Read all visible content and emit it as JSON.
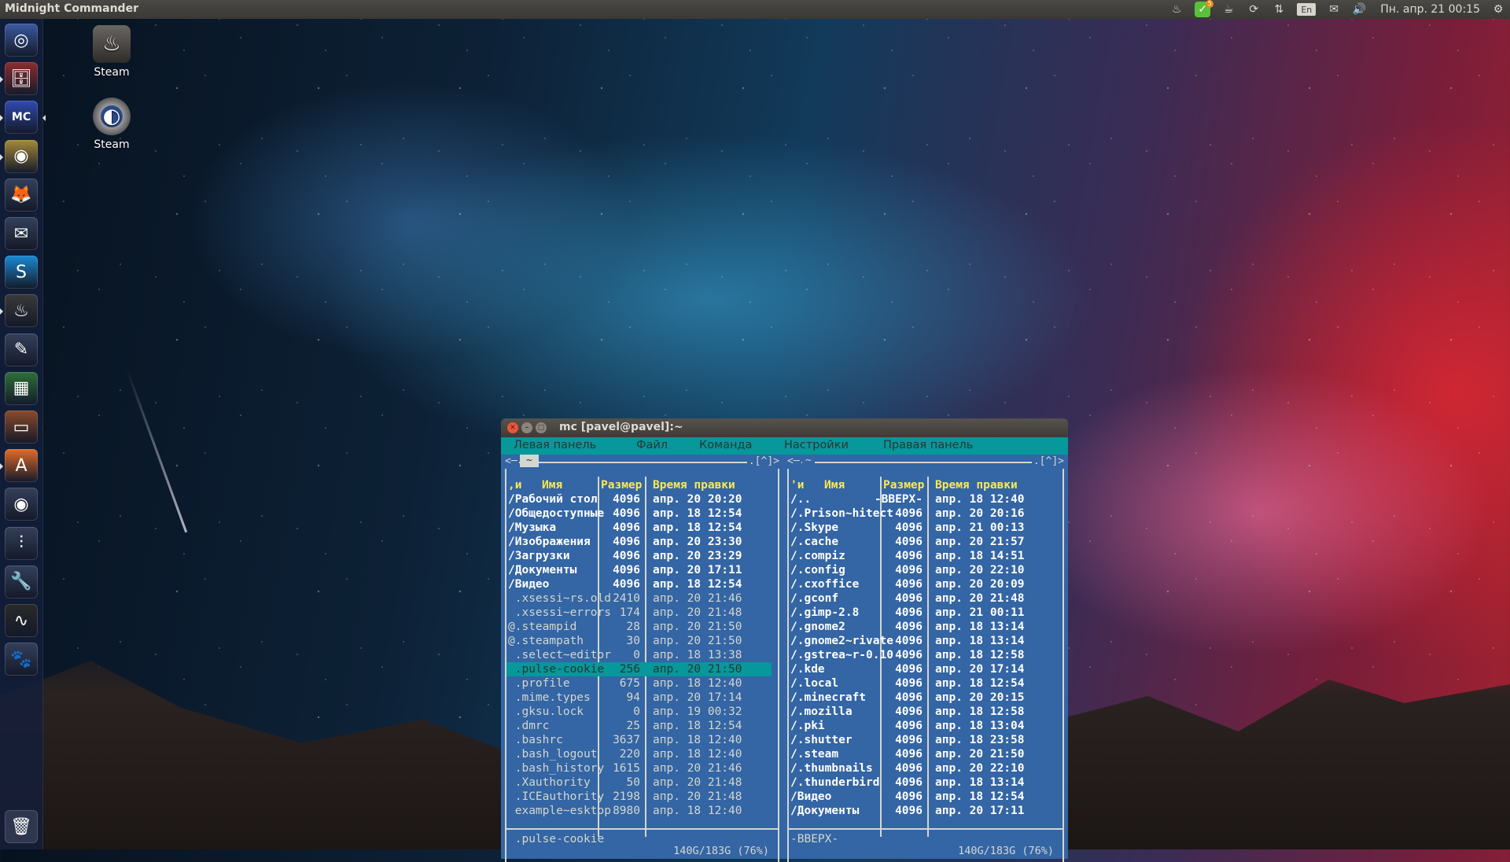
{
  "topbar": {
    "app_title": "Midnight Commander",
    "indicators": [
      {
        "icon": "steam-icon",
        "glyph": "♨"
      },
      {
        "icon": "skype-status-icon",
        "glyph": "✓",
        "badge": "5"
      },
      {
        "icon": "cup-icon",
        "glyph": "☕"
      },
      {
        "icon": "sync-icon",
        "glyph": "⟳"
      },
      {
        "icon": "network-icon",
        "glyph": "⇅"
      },
      {
        "icon": "keyboard-layout-icon",
        "glyph": "En"
      },
      {
        "icon": "mail-icon",
        "glyph": "✉"
      },
      {
        "icon": "volume-icon",
        "glyph": "🔊"
      }
    ],
    "clock": "Пн. апр. 21 00:15",
    "session_icon": "⚙"
  },
  "launcher": {
    "items": [
      {
        "name": "dash-home",
        "glyph": "◎",
        "bg": "#3b5aa0"
      },
      {
        "name": "files",
        "glyph": "🗄",
        "bg": "#8a2e2e"
      },
      {
        "name": "midnight-commander",
        "glyph": "MC",
        "bg": "#2f4bb0",
        "active": true
      },
      {
        "name": "chrome",
        "glyph": "◉",
        "bg": "#a58a3a"
      },
      {
        "name": "firefox",
        "glyph": "🦊",
        "bg": "#34405a"
      },
      {
        "name": "thunderbird",
        "glyph": "✉",
        "bg": "#34405a"
      },
      {
        "name": "skype",
        "glyph": "S",
        "bg": "#1a8ad4"
      },
      {
        "name": "steam",
        "glyph": "♨",
        "bg": "#3a3a3a"
      },
      {
        "name": "libreoffice-writer",
        "glyph": "✎",
        "bg": "#34405a"
      },
      {
        "name": "libreoffice-calc",
        "glyph": "▦",
        "bg": "#2f6f3a"
      },
      {
        "name": "libreoffice-impress",
        "glyph": "▭",
        "bg": "#8a4a2a"
      },
      {
        "name": "software-center",
        "glyph": "A",
        "bg": "#e06b2a"
      },
      {
        "name": "audio-player",
        "glyph": "◉",
        "bg": "#34405a"
      },
      {
        "name": "sound-mixer",
        "glyph": "⫶",
        "bg": "#34405a"
      },
      {
        "name": "system-settings",
        "glyph": "🔧",
        "bg": "#34405a"
      },
      {
        "name": "system-monitor",
        "glyph": "∿",
        "bg": "#2a2a2a"
      },
      {
        "name": "gimp",
        "glyph": "🐾",
        "bg": "#34405a"
      }
    ],
    "trash": {
      "name": "trash",
      "glyph": "🗑"
    }
  },
  "desktop_icons": [
    {
      "label": "Steam",
      "glyph": "♨"
    },
    {
      "label": "Steam",
      "glyph": "◐"
    }
  ],
  "window": {
    "title": "mc [pavel@pavel]:~",
    "menu": [
      "Левая панель",
      "Файл",
      "Команда",
      "Настройки",
      "Правая панель"
    ]
  },
  "left_panel": {
    "corner_left": "<─",
    "path": "~",
    "corner_right": ".[^]>",
    "sort_indicator": ",и",
    "headers": {
      "name": "Имя",
      "size": "Размер",
      "mtime": "Время правки"
    },
    "rows": [
      {
        "name": "/Рабочий стол",
        "size": "4096",
        "mtime": "апр. 20 20:20",
        "dir": true
      },
      {
        "name": "/Общедоступные",
        "size": "4096",
        "mtime": "апр. 18 12:54",
        "dir": true
      },
      {
        "name": "/Музыка",
        "size": "4096",
        "mtime": "апр. 18 12:54",
        "dir": true
      },
      {
        "name": "/Изображения",
        "size": "4096",
        "mtime": "апр. 20 23:30",
        "dir": true
      },
      {
        "name": "/Загрузки",
        "size": "4096",
        "mtime": "апр. 20 23:29",
        "dir": true
      },
      {
        "name": "/Документы",
        "size": "4096",
        "mtime": "апр. 20 17:11",
        "dir": true
      },
      {
        "name": "/Видео",
        "size": "4096",
        "mtime": "апр. 18 12:54",
        "dir": true
      },
      {
        "name": " .xsessi~rs.old",
        "size": "2410",
        "mtime": "апр. 20 21:46"
      },
      {
        "name": " .xsessi~errors",
        "size": "174",
        "mtime": "апр. 20 21:48"
      },
      {
        "name": "@.steampid",
        "size": "28",
        "mtime": "апр. 20 21:50"
      },
      {
        "name": "@.steampath",
        "size": "30",
        "mtime": "апр. 20 21:50"
      },
      {
        "name": " .select~editor",
        "size": "0",
        "mtime": "апр. 18 13:38"
      },
      {
        "name": " .pulse-cookie",
        "size": "256",
        "mtime": "апр. 20 21:50",
        "selected": true
      },
      {
        "name": " .profile",
        "size": "675",
        "mtime": "апр. 18 12:40"
      },
      {
        "name": " .mime.types",
        "size": "94",
        "mtime": "апр. 20 17:14"
      },
      {
        "name": " .gksu.lock",
        "size": "0",
        "mtime": "апр. 19 00:32"
      },
      {
        "name": " .dmrc",
        "size": "25",
        "mtime": "апр. 18 12:54"
      },
      {
        "name": " .bashrc",
        "size": "3637",
        "mtime": "апр. 18 12:40"
      },
      {
        "name": " .bash_logout",
        "size": "220",
        "mtime": "апр. 18 12:40"
      },
      {
        "name": " .bash_history",
        "size": "1615",
        "mtime": "апр. 20 21:46"
      },
      {
        "name": " .Xauthority",
        "size": "50",
        "mtime": "апр. 20 21:48"
      },
      {
        "name": " .ICEauthority",
        "size": "2198",
        "mtime": "апр. 20 21:48"
      },
      {
        "name": " example~esktop",
        "size": "8980",
        "mtime": "апр. 18 12:40"
      }
    ],
    "status": " .pulse-cookie",
    "footer": "140G/183G (76%)"
  },
  "right_panel": {
    "corner_left": "<─",
    "path": "~",
    "corner_right": ".[^]>",
    "sort_indicator": "'и",
    "headers": {
      "name": "Имя",
      "size": "Размер",
      "mtime": "Время правки"
    },
    "rows": [
      {
        "name": "/..",
        "size": "-ВВЕРХ-",
        "mtime": "апр. 18 12:40",
        "dir": true
      },
      {
        "name": "/.Prison~hitect",
        "size": "4096",
        "mtime": "апр. 20 20:16",
        "dir": true
      },
      {
        "name": "/.Skype",
        "size": "4096",
        "mtime": "апр. 21 00:13",
        "dir": true
      },
      {
        "name": "/.cache",
        "size": "4096",
        "mtime": "апр. 20 21:57",
        "dir": true
      },
      {
        "name": "/.compiz",
        "size": "4096",
        "mtime": "апр. 18 14:51",
        "dir": true
      },
      {
        "name": "/.config",
        "size": "4096",
        "mtime": "апр. 20 22:10",
        "dir": true
      },
      {
        "name": "/.cxoffice",
        "size": "4096",
        "mtime": "апр. 20 20:09",
        "dir": true
      },
      {
        "name": "/.gconf",
        "size": "4096",
        "mtime": "апр. 20 21:48",
        "dir": true
      },
      {
        "name": "/.gimp-2.8",
        "size": "4096",
        "mtime": "апр. 21 00:11",
        "dir": true
      },
      {
        "name": "/.gnome2",
        "size": "4096",
        "mtime": "апр. 18 13:14",
        "dir": true
      },
      {
        "name": "/.gnome2~rivate",
        "size": "4096",
        "mtime": "апр. 18 13:14",
        "dir": true
      },
      {
        "name": "/.gstrea~r-0.10",
        "size": "4096",
        "mtime": "апр. 18 12:58",
        "dir": true
      },
      {
        "name": "/.kde",
        "size": "4096",
        "mtime": "апр. 20 17:14",
        "dir": true
      },
      {
        "name": "/.local",
        "size": "4096",
        "mtime": "апр. 18 12:54",
        "dir": true
      },
      {
        "name": "/.minecraft",
        "size": "4096",
        "mtime": "апр. 20 20:15",
        "dir": true
      },
      {
        "name": "/.mozilla",
        "size": "4096",
        "mtime": "апр. 18 12:58",
        "dir": true
      },
      {
        "name": "/.pki",
        "size": "4096",
        "mtime": "апр. 18 13:04",
        "dir": true
      },
      {
        "name": "/.shutter",
        "size": "4096",
        "mtime": "апр. 18 23:58",
        "dir": true
      },
      {
        "name": "/.steam",
        "size": "4096",
        "mtime": "апр. 20 21:50",
        "dir": true
      },
      {
        "name": "/.thumbnails",
        "size": "4096",
        "mtime": "апр. 20 22:10",
        "dir": true
      },
      {
        "name": "/.thunderbird",
        "size": "4096",
        "mtime": "апр. 18 13:14",
        "dir": true
      },
      {
        "name": "/Видео",
        "size": "4096",
        "mtime": "апр. 18 12:54",
        "dir": true
      },
      {
        "name": "/Документы",
        "size": "4096",
        "mtime": "апр. 20 17:11",
        "dir": true
      }
    ],
    "status": "-ВВЕРХ-",
    "footer": "140G/183G (76%)"
  }
}
